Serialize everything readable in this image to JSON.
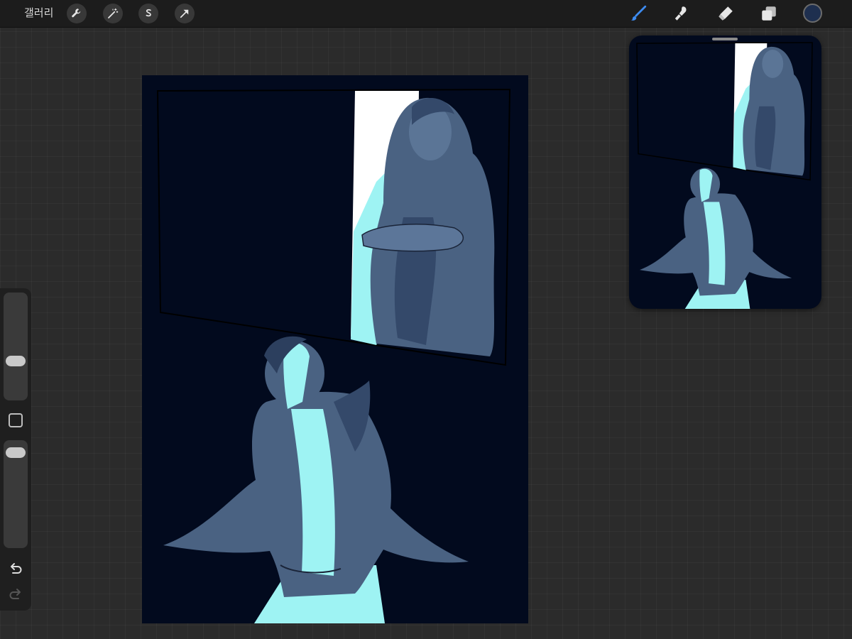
{
  "topbar": {
    "gallery_label": "갤러리",
    "left_tools": [
      {
        "name": "wrench-icon",
        "label": "actions"
      },
      {
        "name": "magic-wand-icon",
        "label": "adjustments"
      },
      {
        "name": "selection-s-icon",
        "label": "selection"
      },
      {
        "name": "arrow-cursor-icon",
        "label": "transform"
      }
    ],
    "right_tools": [
      {
        "name": "brush-icon",
        "active": true
      },
      {
        "name": "smudge-icon",
        "active": false
      },
      {
        "name": "eraser-icon",
        "active": false
      },
      {
        "name": "layers-icon",
        "active": false
      }
    ],
    "current_color": "#1e2f4f"
  },
  "sidebar": {
    "brush_size_level": 0.34,
    "opacity_level": 0.95,
    "icons": [
      "modify-square-icon",
      "undo-icon",
      "redo-icon"
    ]
  },
  "colors": {
    "canvas_bg": "#020a1e",
    "figure_shade": "#4a6282",
    "figure_dark": "#34496a",
    "highlight": "#9ef3f3",
    "white_panel": "#ffffff"
  }
}
